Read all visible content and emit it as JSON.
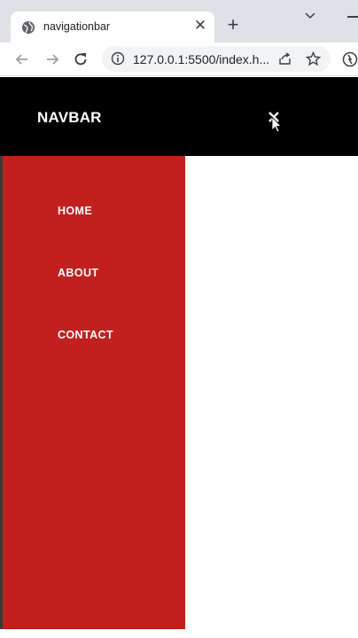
{
  "browser": {
    "tab_title": "navigationbar",
    "tab_close_glyph": "✕",
    "new_tab_glyph": "+",
    "url": "127.0.0.1:5500/index.h..."
  },
  "navbar": {
    "brand": "NAVBAR"
  },
  "menu": {
    "items": [
      {
        "label": "HOME"
      },
      {
        "label": "ABOUT"
      },
      {
        "label": "CONTACT"
      }
    ]
  },
  "colors": {
    "navbar_bg": "#000000",
    "menu_bg": "#c21f1f",
    "menu_text": "#ffffff"
  }
}
